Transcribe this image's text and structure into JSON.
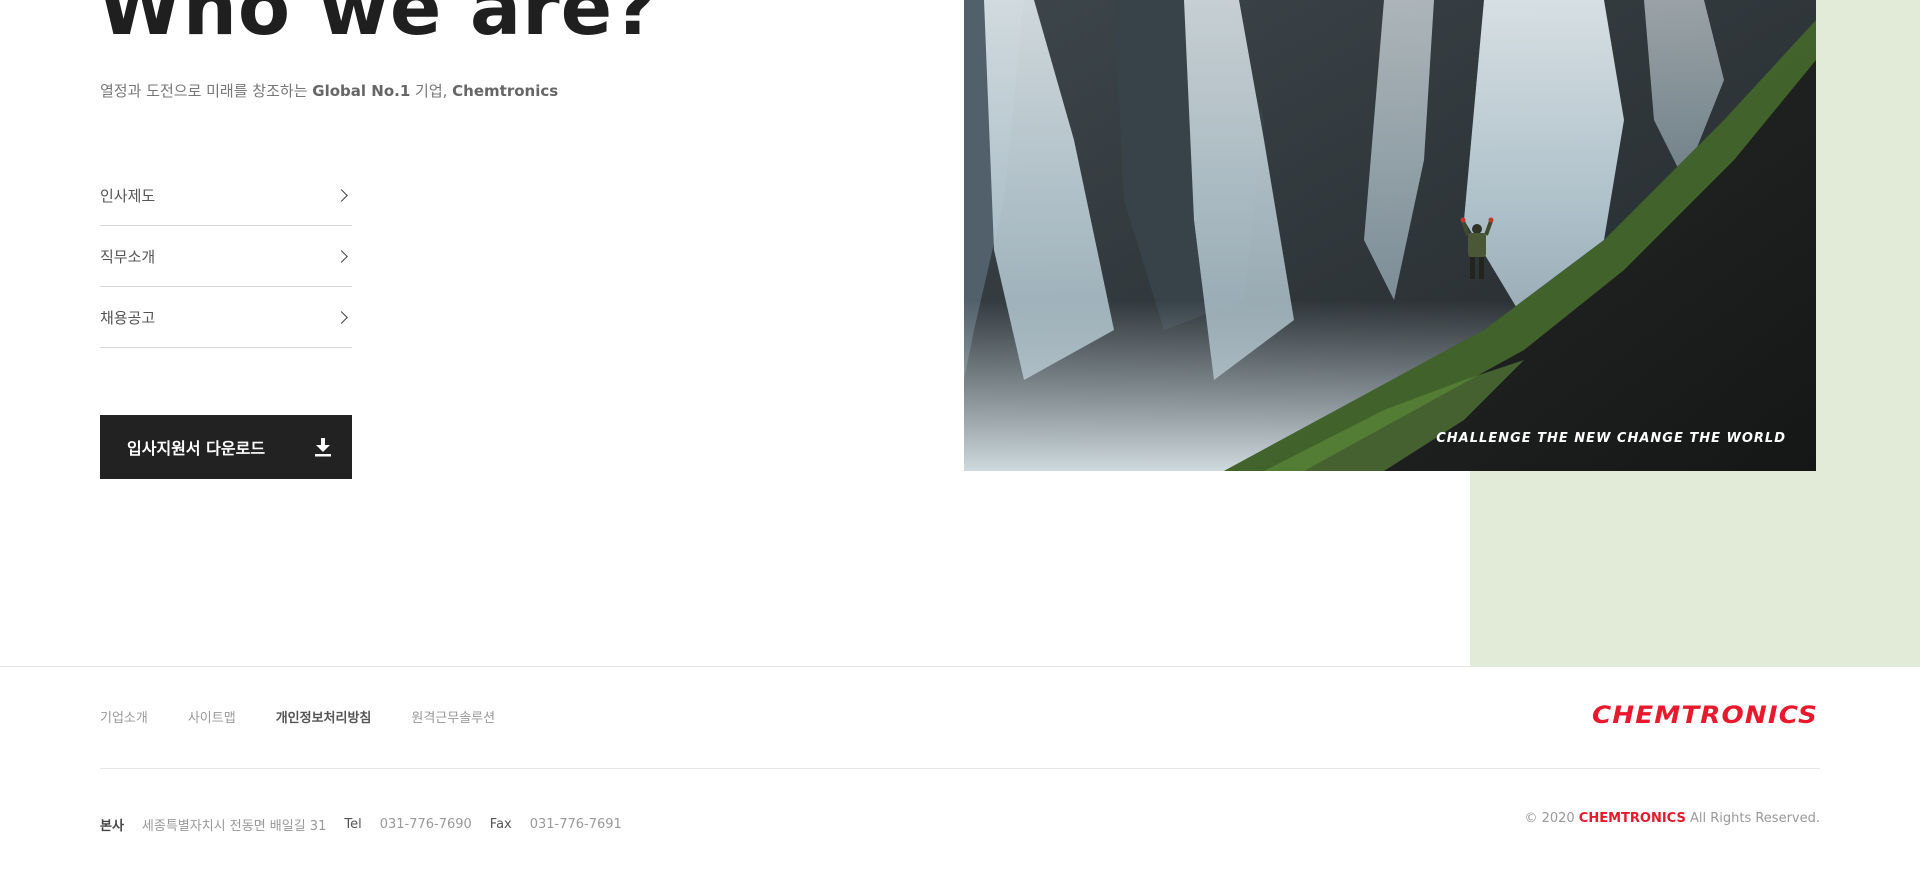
{
  "hero": {
    "title": "Who we are?",
    "subtitle_prefix": "열정과 도전으로 미래를 창조하는 ",
    "subtitle_bold1": "Global No.1",
    "subtitle_mid": " 기업, ",
    "subtitle_bold2": "Chemtronics"
  },
  "menu": {
    "items": [
      {
        "label": "인사제도"
      },
      {
        "label": "직무소개"
      },
      {
        "label": "채용공고"
      }
    ]
  },
  "download": {
    "label": "입사지원서 다운로드",
    "icon": "download-icon"
  },
  "photo": {
    "slogan": "CHALLENGE  THE NEW  CHANGE THE WORLD"
  },
  "footer": {
    "links": [
      {
        "label": "기업소개",
        "strong": false
      },
      {
        "label": "사이트맵",
        "strong": false
      },
      {
        "label": "개인정보처리방침",
        "strong": true
      },
      {
        "label": "원격근무솔루션",
        "strong": false
      }
    ],
    "logo_text": "CHEMTRONICS",
    "logo_color": "#e8192c",
    "hq_label": "본사",
    "hq_address": "세종특별자치시 전동면 배일길 31",
    "tel_label": "Tel",
    "tel_value": "031-776-7690",
    "fax_label": "Fax",
    "fax_value": "031-776-7691",
    "copyright_prefix": "© 2020 ",
    "copyright_brand": "CHEMTRONICS",
    "copyright_suffix": " All Rights Reserved."
  },
  "colors": {
    "accent_red": "#e8192c",
    "green_panel": "#e1ebd8",
    "dark_button": "#222222"
  }
}
